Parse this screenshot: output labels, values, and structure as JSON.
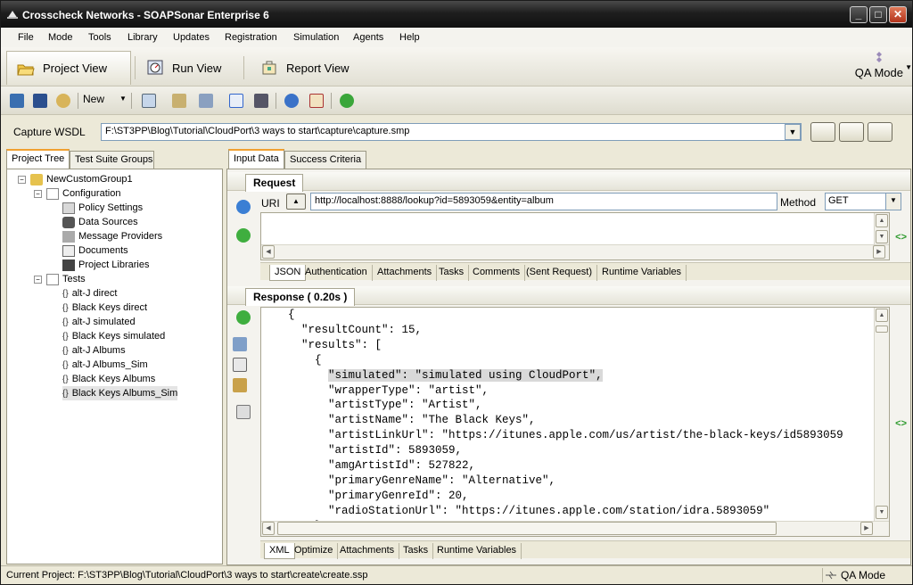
{
  "window": {
    "title": "Crosscheck Networks - SOAPSonar Enterprise 6"
  },
  "menu": [
    "File",
    "Mode",
    "Tools",
    "Library",
    "Updates",
    "Registration",
    "Simulation",
    "Agents",
    "Help"
  ],
  "views": {
    "project": "Project View",
    "run": "Run View",
    "report": "Report View",
    "qa_mode": "QA Mode"
  },
  "toolbar": {
    "new_label": "New"
  },
  "capture": {
    "label": "Capture WSDL",
    "path": "F:\\ST3PP\\Blog\\Tutorial\\CloudPort\\3 ways to start\\capture\\capture.smp"
  },
  "left_tabs": [
    "Project Tree",
    "Test Suite Groups"
  ],
  "tree": {
    "root": "NewCustomGroup1",
    "configuration": "Configuration",
    "config_items": [
      "Policy Settings",
      "Data Sources",
      "Message Providers",
      "Documents",
      "Project Libraries"
    ],
    "tests": "Tests",
    "test_items": [
      "alt-J direct",
      "Black Keys direct",
      "alt-J simulated",
      "Black Keys simulated",
      "alt-J Albums",
      "alt-J Albums_Sim",
      "Black Keys Albums",
      "Black Keys Albums_Sim"
    ]
  },
  "right_tabs": [
    "Input Data",
    "Success Criteria"
  ],
  "request": {
    "header": "Request",
    "uri_label": "URI",
    "uri": "http://localhost:8888/lookup?id=5893059&entity=album",
    "method_label": "Method",
    "method": "GET",
    "tabs": [
      "JSON",
      "Authentication",
      "Attachments",
      "Tasks",
      "Comments",
      "(Sent Request)",
      "Runtime Variables"
    ]
  },
  "response": {
    "header": "Response ( 0.20s )",
    "lines": [
      "{",
      "  \"resultCount\": 15,",
      "  \"results\": [",
      "    {",
      "      \"simulated\": \"simulated using CloudPort\",",
      "      \"wrapperType\": \"artist\",",
      "      \"artistType\": \"Artist\",",
      "      \"artistName\": \"The Black Keys\",",
      "      \"artistLinkUrl\": \"https://itunes.apple.com/us/artist/the-black-keys/id5893059",
      "      \"artistId\": 5893059,",
      "      \"amgArtistId\": 527822,",
      "      \"primaryGenreName\": \"Alternative\",",
      "      \"primaryGenreId\": 20,",
      "      \"radioStationUrl\": \"https://itunes.apple.com/station/idra.5893059\"",
      "    },"
    ],
    "tabs": [
      "XML",
      "Optimize",
      "Attachments",
      "Tasks",
      "Runtime Variables"
    ]
  },
  "status": {
    "text": "Current Project: F:\\ST3PP\\Blog\\Tutorial\\CloudPort\\3 ways to start\\create\\create.ssp",
    "mode": "QA Mode"
  }
}
